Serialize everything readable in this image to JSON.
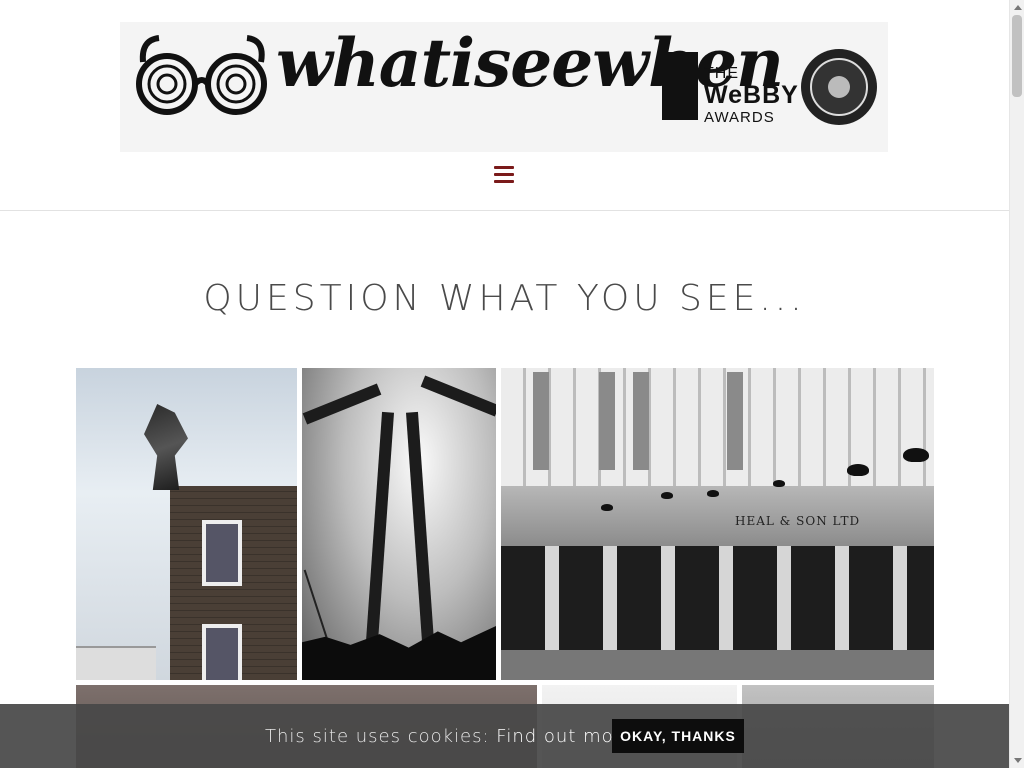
{
  "brand": {
    "name": "whatiseewhen"
  },
  "award": {
    "line1": "THE",
    "line2": "WeBBY",
    "line3": "AWARDS"
  },
  "icons": {
    "menu": "hamburger-menu-icon",
    "glasses": "glasses-logo-icon",
    "badge": "webby-honoree-badge-icon"
  },
  "colors": {
    "menu_icon": "#7a1a1a",
    "cookie_bar": "#484848",
    "cookie_button": "#0d0d0d"
  },
  "tagline": "QUESTION WHAT YOU SEE...",
  "gallery": {
    "photos": [
      {
        "label": "sculpture-on-brick-building"
      },
      {
        "label": "industrial-chimneys-with-crane"
      },
      {
        "label": "heals-shopfront-with-crows",
        "sign": "HEAL & SON LTD"
      },
      {
        "label": "bare-trees"
      },
      {
        "label": "pale-sky"
      },
      {
        "label": "grey-sky"
      }
    ]
  },
  "cookie": {
    "text": "This site uses cookies:",
    "link": "Find out more.",
    "button": "OKAY, THANKS"
  }
}
